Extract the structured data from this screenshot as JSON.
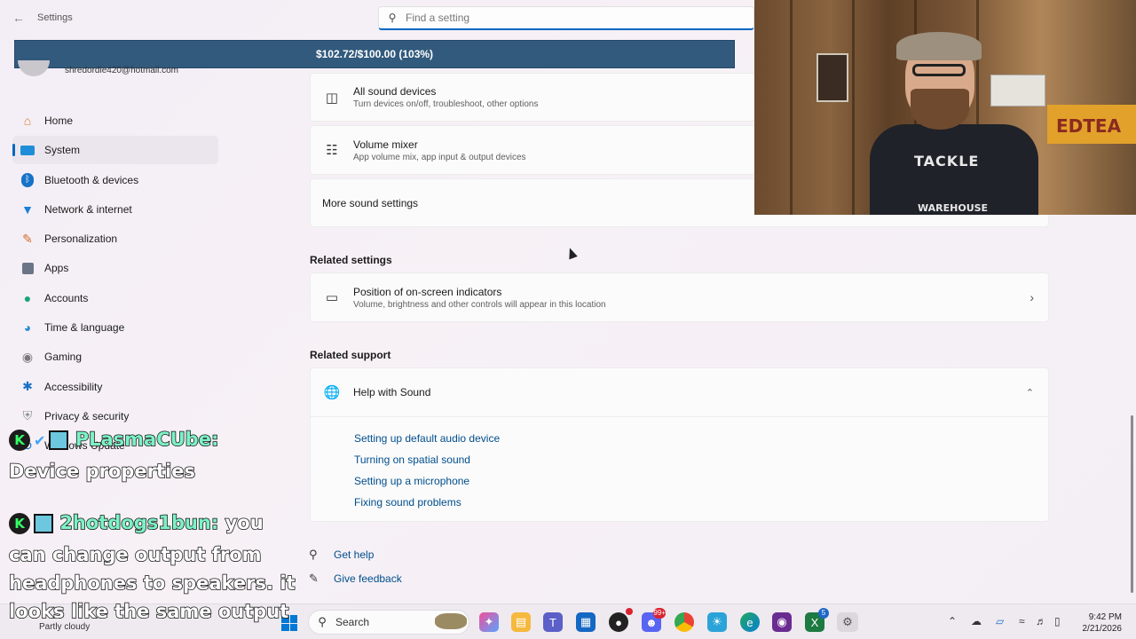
{
  "titlebar": {
    "app_title": "Settings",
    "search_placeholder": "Find a setting"
  },
  "donation": {
    "text": "$102.72/$100.00 (103%)",
    "progress_percent": 103
  },
  "account": {
    "email": "shredordie420@hotmail.com"
  },
  "sidebar": {
    "items": [
      {
        "label": "Home",
        "icon": "home-icon"
      },
      {
        "label": "System",
        "icon": "system-icon",
        "active": true
      },
      {
        "label": "Bluetooth & devices",
        "icon": "bluetooth-icon"
      },
      {
        "label": "Network & internet",
        "icon": "wifi-icon"
      },
      {
        "label": "Personalization",
        "icon": "brush-icon"
      },
      {
        "label": "Apps",
        "icon": "apps-icon"
      },
      {
        "label": "Accounts",
        "icon": "person-icon"
      },
      {
        "label": "Time & language",
        "icon": "globe-icon"
      },
      {
        "label": "Gaming",
        "icon": "controller-icon"
      },
      {
        "label": "Accessibility",
        "icon": "accessibility-icon"
      },
      {
        "label": "Privacy & security",
        "icon": "shield-icon"
      },
      {
        "label": "Windows Update",
        "icon": "update-icon"
      }
    ]
  },
  "main": {
    "sound_items": [
      {
        "title": "All sound devices",
        "subtitle": "Turn devices on/off, troubleshoot, other options"
      },
      {
        "title": "Volume mixer",
        "subtitle": "App volume mix, app input & output devices"
      },
      {
        "title": "More sound settings",
        "subtitle": ""
      }
    ],
    "related_settings": {
      "heading": "Related settings",
      "item": {
        "title": "Position of on-screen indicators",
        "subtitle": "Volume, brightness and other controls will appear in this location"
      }
    },
    "related_support": {
      "heading": "Related support",
      "help_title": "Help with Sound",
      "links": [
        "Setting up default audio device",
        "Turning on spatial sound",
        "Setting up a microphone",
        "Fixing sound problems"
      ]
    },
    "footer": {
      "get_help": "Get help",
      "give_feedback": "Give feedback"
    }
  },
  "webcam": {
    "banner_text": "EDTEA",
    "shirt_top": "TACKLE",
    "shirt_bottom": "WAREHOUSE"
  },
  "chat": [
    {
      "user": "PLasmaCUbe:",
      "message_lines": [
        "Device properties"
      ]
    },
    {
      "user": "2hotdogs1bun:",
      "message_lines": [
        "you",
        "can change output from",
        "headphones to speakers. it",
        "looks like the same output"
      ]
    }
  ],
  "taskbar": {
    "weather": "Partly cloudy",
    "search_label": "Search",
    "badges": {
      "discord": "99+",
      "teams": "5"
    },
    "time": "9:42 PM",
    "date": "2/21/2026"
  },
  "colors": {
    "accent": "#0067c0",
    "donation_bar": "#315a7d",
    "link": "#004e8c"
  }
}
